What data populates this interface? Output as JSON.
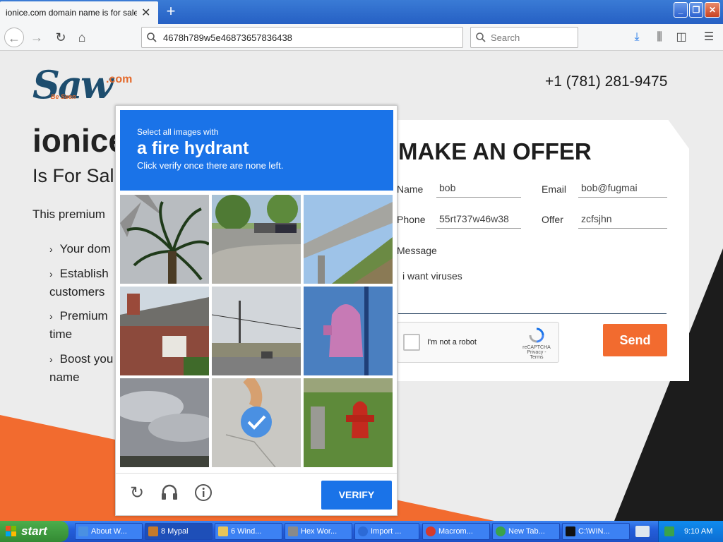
{
  "browser": {
    "tab_title": "ionice.com domain name is for sale. Inq",
    "tab_close": "✕",
    "new_tab": "+",
    "url": "4678h789w5e46873657836438",
    "search_placeholder": "Search"
  },
  "site": {
    "logo_text": "Saw",
    "logo_com": ".com",
    "logo_tagline": "Be Seen",
    "phone": "+1 (781) 281-9475",
    "domain": "ionice",
    "for_sale": "Is For Sal",
    "premium": "This premium",
    "features": [
      {
        "line1": "Your dom",
        "line2": ""
      },
      {
        "line1": "Establish",
        "line2": "customers"
      },
      {
        "line1": "Premium",
        "line2": "time"
      },
      {
        "line1": "Boost you",
        "line2": "name"
      }
    ],
    "chevron": "›"
  },
  "offer_form": {
    "title": "MAKE AN OFFER",
    "name_label": "Name",
    "name_value": "bob",
    "email_label": "Email",
    "email_value": "bob@fugmai",
    "phone_label": "Phone",
    "phone_value": "55rt737w46w38",
    "offer_label": "Offer",
    "offer_value": "zcfsjhn",
    "message_label": "Message",
    "message_value": "i want viruses",
    "recaptcha_label": "I'm not a robot",
    "recaptcha_brand": "reCAPTCHA",
    "recaptcha_links": "Privacy - Terms",
    "send_label": "Send"
  },
  "challenge": {
    "small_text": "Select all images with",
    "big_text": "a fire hydrant",
    "instruction": "Click verify once there are none left.",
    "verify_label": "VERIFY",
    "tiles": [
      {
        "subject": "palm tree",
        "selected": false
      },
      {
        "subject": "parking lot",
        "selected": false
      },
      {
        "subject": "overpass",
        "selected": false
      },
      {
        "subject": "house",
        "selected": false
      },
      {
        "subject": "street with poles",
        "selected": false
      },
      {
        "subject": "fire hydrant close-up",
        "selected": false
      },
      {
        "subject": "cloudy sky",
        "selected": false
      },
      {
        "subject": "pavement",
        "selected": true
      },
      {
        "subject": "fire hydrant",
        "selected": false
      }
    ]
  },
  "taskbar": {
    "start": "start",
    "items": [
      {
        "label": "About W...",
        "color": "#4a90e2"
      },
      {
        "label": "8 Mypal",
        "color": "#c47a2b"
      },
      {
        "label": "6 Wind...",
        "color": "#e8c55a"
      },
      {
        "label": "Hex Wor...",
        "color": "#8a8a8a"
      },
      {
        "label": "Import ...",
        "color": "#2c6ad6"
      },
      {
        "label": "Macrom...",
        "color": "#d63a2c"
      },
      {
        "label": "New Tab...",
        "color": "#3aa34a"
      },
      {
        "label": "C:\\WIN...",
        "color": "#111111"
      }
    ],
    "clock": "9:10 AM"
  },
  "colors": {
    "accent_blue": "#1a73e8",
    "send_orange": "#f26b2f",
    "brand_navy": "#1d4d6e"
  }
}
